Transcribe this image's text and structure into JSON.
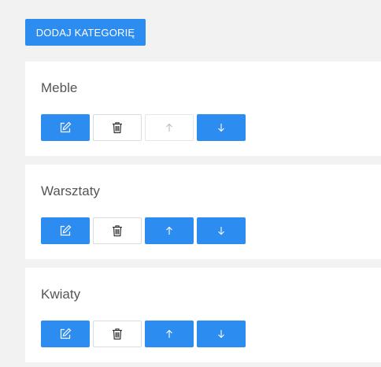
{
  "toolbar": {
    "add_category_label": "DODAJ KATEGORIĘ"
  },
  "categories": [
    {
      "name": "Meble",
      "actions": {
        "edit": "enabled",
        "delete": "enabled",
        "move_up": "disabled",
        "move_down": "enabled"
      }
    },
    {
      "name": "Warsztaty",
      "actions": {
        "edit": "enabled",
        "delete": "enabled",
        "move_up": "enabled",
        "move_down": "enabled"
      }
    },
    {
      "name": "Kwiaty",
      "actions": {
        "edit": "enabled",
        "delete": "enabled",
        "move_up": "enabled",
        "move_down": "enabled"
      }
    }
  ],
  "icons": {
    "edit": "edit-icon",
    "delete": "trash-icon",
    "move_up": "arrow-up-icon",
    "move_down": "arrow-down-icon"
  },
  "colors": {
    "primary": "#2d8cf0",
    "background": "#f2f2f2",
    "card": "#ffffff"
  }
}
